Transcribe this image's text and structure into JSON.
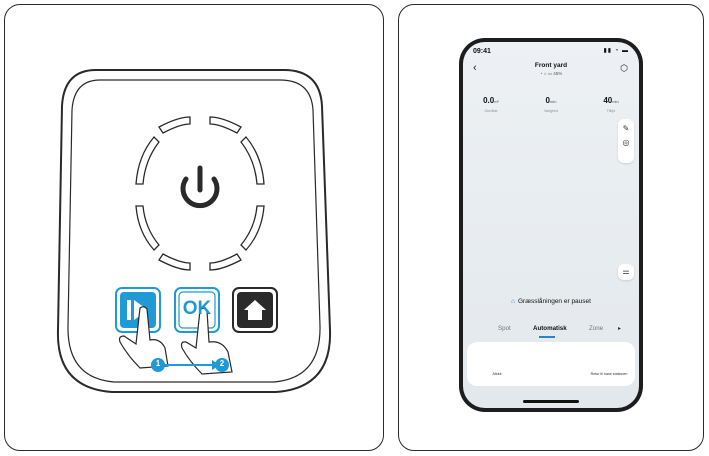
{
  "phone": {
    "time": "09:41",
    "title": "Front yard",
    "subtitle": "45%",
    "stats": [
      {
        "value": "0.0",
        "unit": "m²",
        "label": "Område"
      },
      {
        "value": "0",
        "unit": "min",
        "label": "Varighed"
      },
      {
        "value": "40",
        "unit": "min",
        "label": "Tilbjö"
      }
    ],
    "status_message": "Græsslåningen er pauset",
    "modes": [
      "Spot",
      "Automatisk",
      "Zone"
    ],
    "actions": {
      "stop_label": "Afslut",
      "return_label": "Retur til base stationen"
    }
  },
  "panel": {
    "steps": [
      "1",
      "2"
    ],
    "ok_label": "OK"
  },
  "colors": {
    "accent": "#1f9ad6",
    "dark": "#2a2a2a"
  }
}
